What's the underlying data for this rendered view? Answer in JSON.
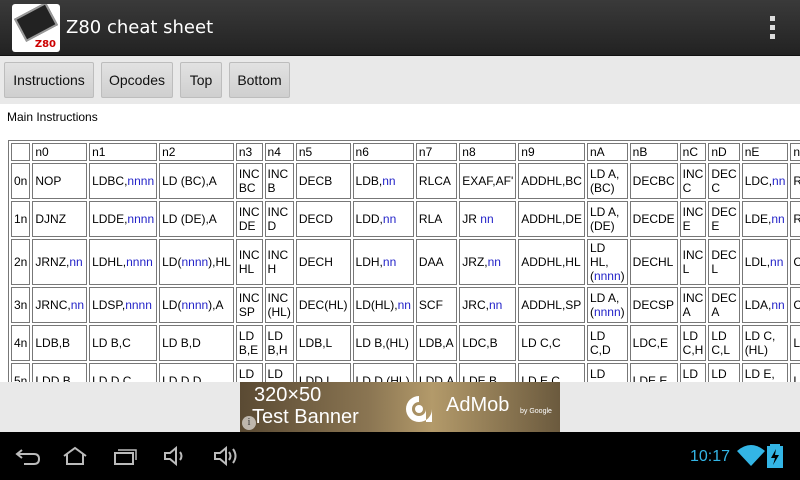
{
  "app": {
    "title": "Z80 cheat sheet",
    "icon_label": "Z80",
    "icon_name": "app-chip-icon"
  },
  "toolbar": {
    "buttons": [
      {
        "label": "Instructions"
      },
      {
        "label": "Opcodes"
      },
      {
        "label": "Top"
      },
      {
        "label": "Bottom"
      }
    ]
  },
  "section_title": "Main Instructions",
  "table": {
    "headers": [
      "",
      "n0",
      "n1",
      "n2",
      "n3",
      "n4",
      "n5",
      "n6",
      "n7",
      "n8",
      "n9",
      "nA",
      "nB",
      "nC",
      "nD",
      "nE",
      "nF"
    ],
    "rows": [
      {
        "label": "0n",
        "cells": [
          [
            [
              "NOP"
            ]
          ],
          [
            [
              "LD"
            ],
            [
              "BC,"
            ],
            [
              "nnnn",
              "n"
            ]
          ],
          [
            [
              "LD (BC),A"
            ]
          ],
          [
            [
              "INC BC"
            ]
          ],
          [
            [
              "INC B"
            ]
          ],
          [
            [
              "DEC"
            ],
            [
              "B"
            ]
          ],
          [
            [
              "LD"
            ],
            [
              "B,"
            ],
            [
              "nn",
              "n"
            ]
          ],
          [
            [
              "RLCA"
            ]
          ],
          [
            [
              "EX"
            ],
            [
              "AF,AF'"
            ]
          ],
          [
            [
              "ADD"
            ],
            [
              "HL,BC"
            ]
          ],
          [
            [
              "LD A,"
            ],
            [
              "(BC)"
            ]
          ],
          [
            [
              "DEC"
            ],
            [
              "BC"
            ]
          ],
          [
            [
              "INC C"
            ]
          ],
          [
            [
              "DEC C"
            ]
          ],
          [
            [
              "LD"
            ],
            [
              "C,"
            ],
            [
              "nn",
              "n"
            ]
          ],
          [
            [
              "RRCA"
            ]
          ]
        ]
      },
      {
        "label": "1n",
        "cells": [
          [
            [
              "DJNZ"
            ]
          ],
          [
            [
              "LD"
            ],
            [
              "DE,"
            ],
            [
              "nnnn",
              "n"
            ]
          ],
          [
            [
              "LD (DE),A"
            ]
          ],
          [
            [
              "INC DE"
            ]
          ],
          [
            [
              "INC D"
            ]
          ],
          [
            [
              "DEC"
            ],
            [
              "D"
            ]
          ],
          [
            [
              "LD"
            ],
            [
              "D,"
            ],
            [
              "nn",
              "n"
            ]
          ],
          [
            [
              "RLA"
            ]
          ],
          [
            [
              "JR "
            ],
            [
              "nn",
              "n"
            ]
          ],
          [
            [
              "ADD"
            ],
            [
              "HL,DE"
            ]
          ],
          [
            [
              "LD A,"
            ],
            [
              "(DE)"
            ]
          ],
          [
            [
              "DEC"
            ],
            [
              "DE"
            ]
          ],
          [
            [
              "INC E"
            ]
          ],
          [
            [
              "DEC E"
            ]
          ],
          [
            [
              "LD"
            ],
            [
              "E,"
            ],
            [
              "nn",
              "n"
            ]
          ],
          [
            [
              "RRA"
            ]
          ]
        ]
      },
      {
        "label": "2n",
        "cells": [
          [
            [
              "JR"
            ],
            [
              "NZ,"
            ],
            [
              "nn",
              "n"
            ]
          ],
          [
            [
              "LD"
            ],
            [
              "HL,"
            ],
            [
              "nnnn",
              "n"
            ]
          ],
          [
            [
              "LD"
            ],
            [
              "("
            ],
            [
              "nnnn",
              "n"
            ],
            [
              "),HL"
            ]
          ],
          [
            [
              "INC HL"
            ]
          ],
          [
            [
              "INC H"
            ]
          ],
          [
            [
              "DEC"
            ],
            [
              "H"
            ]
          ],
          [
            [
              "LD"
            ],
            [
              "H,"
            ],
            [
              "nn",
              "n"
            ]
          ],
          [
            [
              "DAA"
            ]
          ],
          [
            [
              "JR"
            ],
            [
              "Z,"
            ],
            [
              "nn",
              "n"
            ]
          ],
          [
            [
              "ADD"
            ],
            [
              "HL,HL"
            ]
          ],
          [
            [
              "LD HL,"
            ],
            [
              "("
            ],
            [
              "nnnn",
              "n"
            ],
            [
              ")"
            ]
          ],
          [
            [
              "DEC"
            ],
            [
              "HL"
            ]
          ],
          [
            [
              "INC L"
            ]
          ],
          [
            [
              "DEC L"
            ]
          ],
          [
            [
              "LD"
            ],
            [
              "L,"
            ],
            [
              "nn",
              "n"
            ]
          ],
          [
            [
              "CPL"
            ]
          ]
        ]
      },
      {
        "label": "3n",
        "cells": [
          [
            [
              "JR"
            ],
            [
              "NC,"
            ],
            [
              "nn",
              "n"
            ]
          ],
          [
            [
              "LD"
            ],
            [
              "SP,"
            ],
            [
              "nnnn",
              "n"
            ]
          ],
          [
            [
              "LD"
            ],
            [
              "("
            ],
            [
              "nnnn",
              "n"
            ],
            [
              "),A"
            ]
          ],
          [
            [
              "INC SP"
            ]
          ],
          [
            [
              "INC (HL)"
            ]
          ],
          [
            [
              "DEC"
            ],
            [
              "(HL)"
            ]
          ],
          [
            [
              "LD"
            ],
            [
              "(HL),"
            ],
            [
              "nn",
              "n"
            ]
          ],
          [
            [
              "SCF"
            ]
          ],
          [
            [
              "JR"
            ],
            [
              "C,"
            ],
            [
              "nn",
              "n"
            ]
          ],
          [
            [
              "ADD"
            ],
            [
              "HL,SP"
            ]
          ],
          [
            [
              "LD A,"
            ],
            [
              "("
            ],
            [
              "nnnn",
              "n"
            ],
            [
              ")"
            ]
          ],
          [
            [
              "DEC"
            ],
            [
              "SP"
            ]
          ],
          [
            [
              "INC A"
            ]
          ],
          [
            [
              "DEC A"
            ]
          ],
          [
            [
              "LD"
            ],
            [
              "A,"
            ],
            [
              "nn",
              "n"
            ]
          ],
          [
            [
              "CCF"
            ]
          ]
        ]
      },
      {
        "label": "4n",
        "cells": [
          [
            [
              "LD"
            ],
            [
              "B,B"
            ]
          ],
          [
            [
              "LD B,C"
            ]
          ],
          [
            [
              "LD B,D"
            ]
          ],
          [
            [
              "LD B,E"
            ]
          ],
          [
            [
              "LD B,H"
            ]
          ],
          [
            [
              "LD"
            ],
            [
              "B,L"
            ]
          ],
          [
            [
              "LD B,"
            ],
            [
              "(HL)"
            ]
          ],
          [
            [
              "LD"
            ],
            [
              "B,A"
            ]
          ],
          [
            [
              "LD"
            ],
            [
              "C,B"
            ]
          ],
          [
            [
              "LD C,C"
            ]
          ],
          [
            [
              "LD C,D"
            ]
          ],
          [
            [
              "LD"
            ],
            [
              "C,E"
            ]
          ],
          [
            [
              "LD C,H"
            ]
          ],
          [
            [
              "LD C,L"
            ]
          ],
          [
            [
              "LD C,"
            ],
            [
              "(HL)"
            ]
          ],
          [
            [
              "LD"
            ],
            [
              "C,A"
            ]
          ]
        ]
      },
      {
        "label": "5n",
        "cells": [
          [
            [
              "LD"
            ],
            [
              "D,B"
            ]
          ],
          [
            [
              "LD D,C"
            ]
          ],
          [
            [
              "LD D,D"
            ]
          ],
          [
            [
              "LD D,E"
            ]
          ],
          [
            [
              "LD D,H"
            ]
          ],
          [
            [
              "LD"
            ],
            [
              "D,L"
            ]
          ],
          [
            [
              "LD D,"
            ],
            [
              "(HL)"
            ]
          ],
          [
            [
              "LD"
            ],
            [
              "D,A"
            ]
          ],
          [
            [
              "LD"
            ],
            [
              "E,B"
            ]
          ],
          [
            [
              "LD E,C"
            ]
          ],
          [
            [
              "LD E,D"
            ]
          ],
          [
            [
              "LD"
            ],
            [
              "E,E"
            ]
          ],
          [
            [
              "LD E,H"
            ]
          ],
          [
            [
              "LD E,L"
            ]
          ],
          [
            [
              "LD E,"
            ],
            [
              "(HL)"
            ]
          ],
          [
            [
              "LD"
            ],
            [
              "E,A"
            ]
          ]
        ]
      }
    ]
  },
  "ad": {
    "line1": "320×50",
    "line2": "Test Banner",
    "brand": "AdMob",
    "by": "by Google",
    "info": "i"
  },
  "status": {
    "clock": "10:17"
  },
  "nav_icons": [
    "back-icon",
    "home-icon",
    "recent-apps-icon",
    "volume-down-icon",
    "volume-up-icon",
    "wifi-icon",
    "battery-icon"
  ],
  "colors": {
    "link": "#2323c8",
    "clock": "#33b5e5"
  }
}
